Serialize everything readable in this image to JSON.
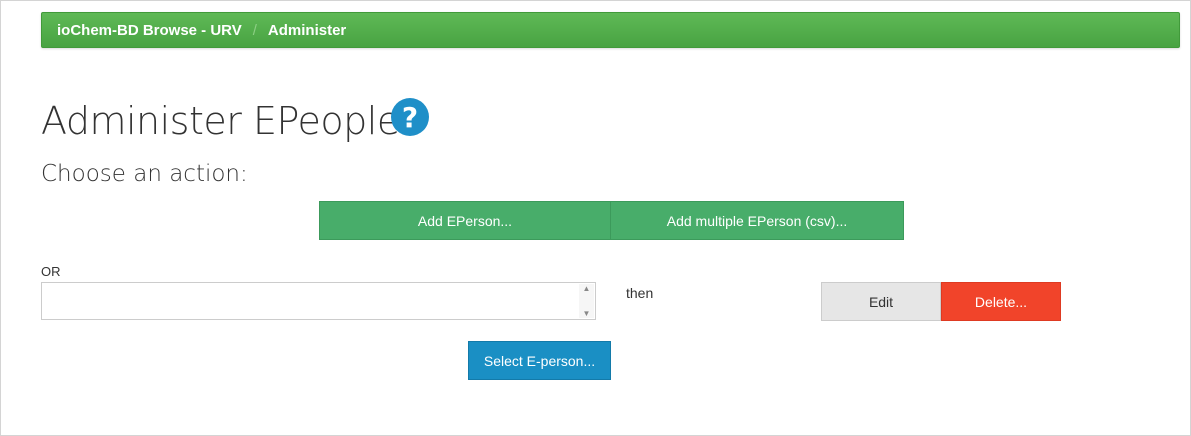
{
  "breadcrumb": {
    "items": [
      "ioChem-BD Browse - URV",
      "Administer"
    ],
    "separator": "/"
  },
  "page": {
    "title": "Administer EPeople",
    "help_icon": "question-circle-icon",
    "subtitle": "Choose an action:"
  },
  "actions": {
    "add_eperson_label": "Add EPerson...",
    "add_multiple_label": "Add multiple EPerson (csv)...",
    "or_label": "OR",
    "eperson_value": "",
    "then_label": "then",
    "edit_label": "Edit",
    "delete_label": "Delete...",
    "select_label": "Select E-person..."
  },
  "colors": {
    "breadcrumb_bg": "#4fae47",
    "green_button": "#48ad6a",
    "help_icon": "#1f8fc8",
    "delete_button": "#f1442a",
    "select_button": "#1a8fc4",
    "edit_button": "#e6e6e6"
  }
}
